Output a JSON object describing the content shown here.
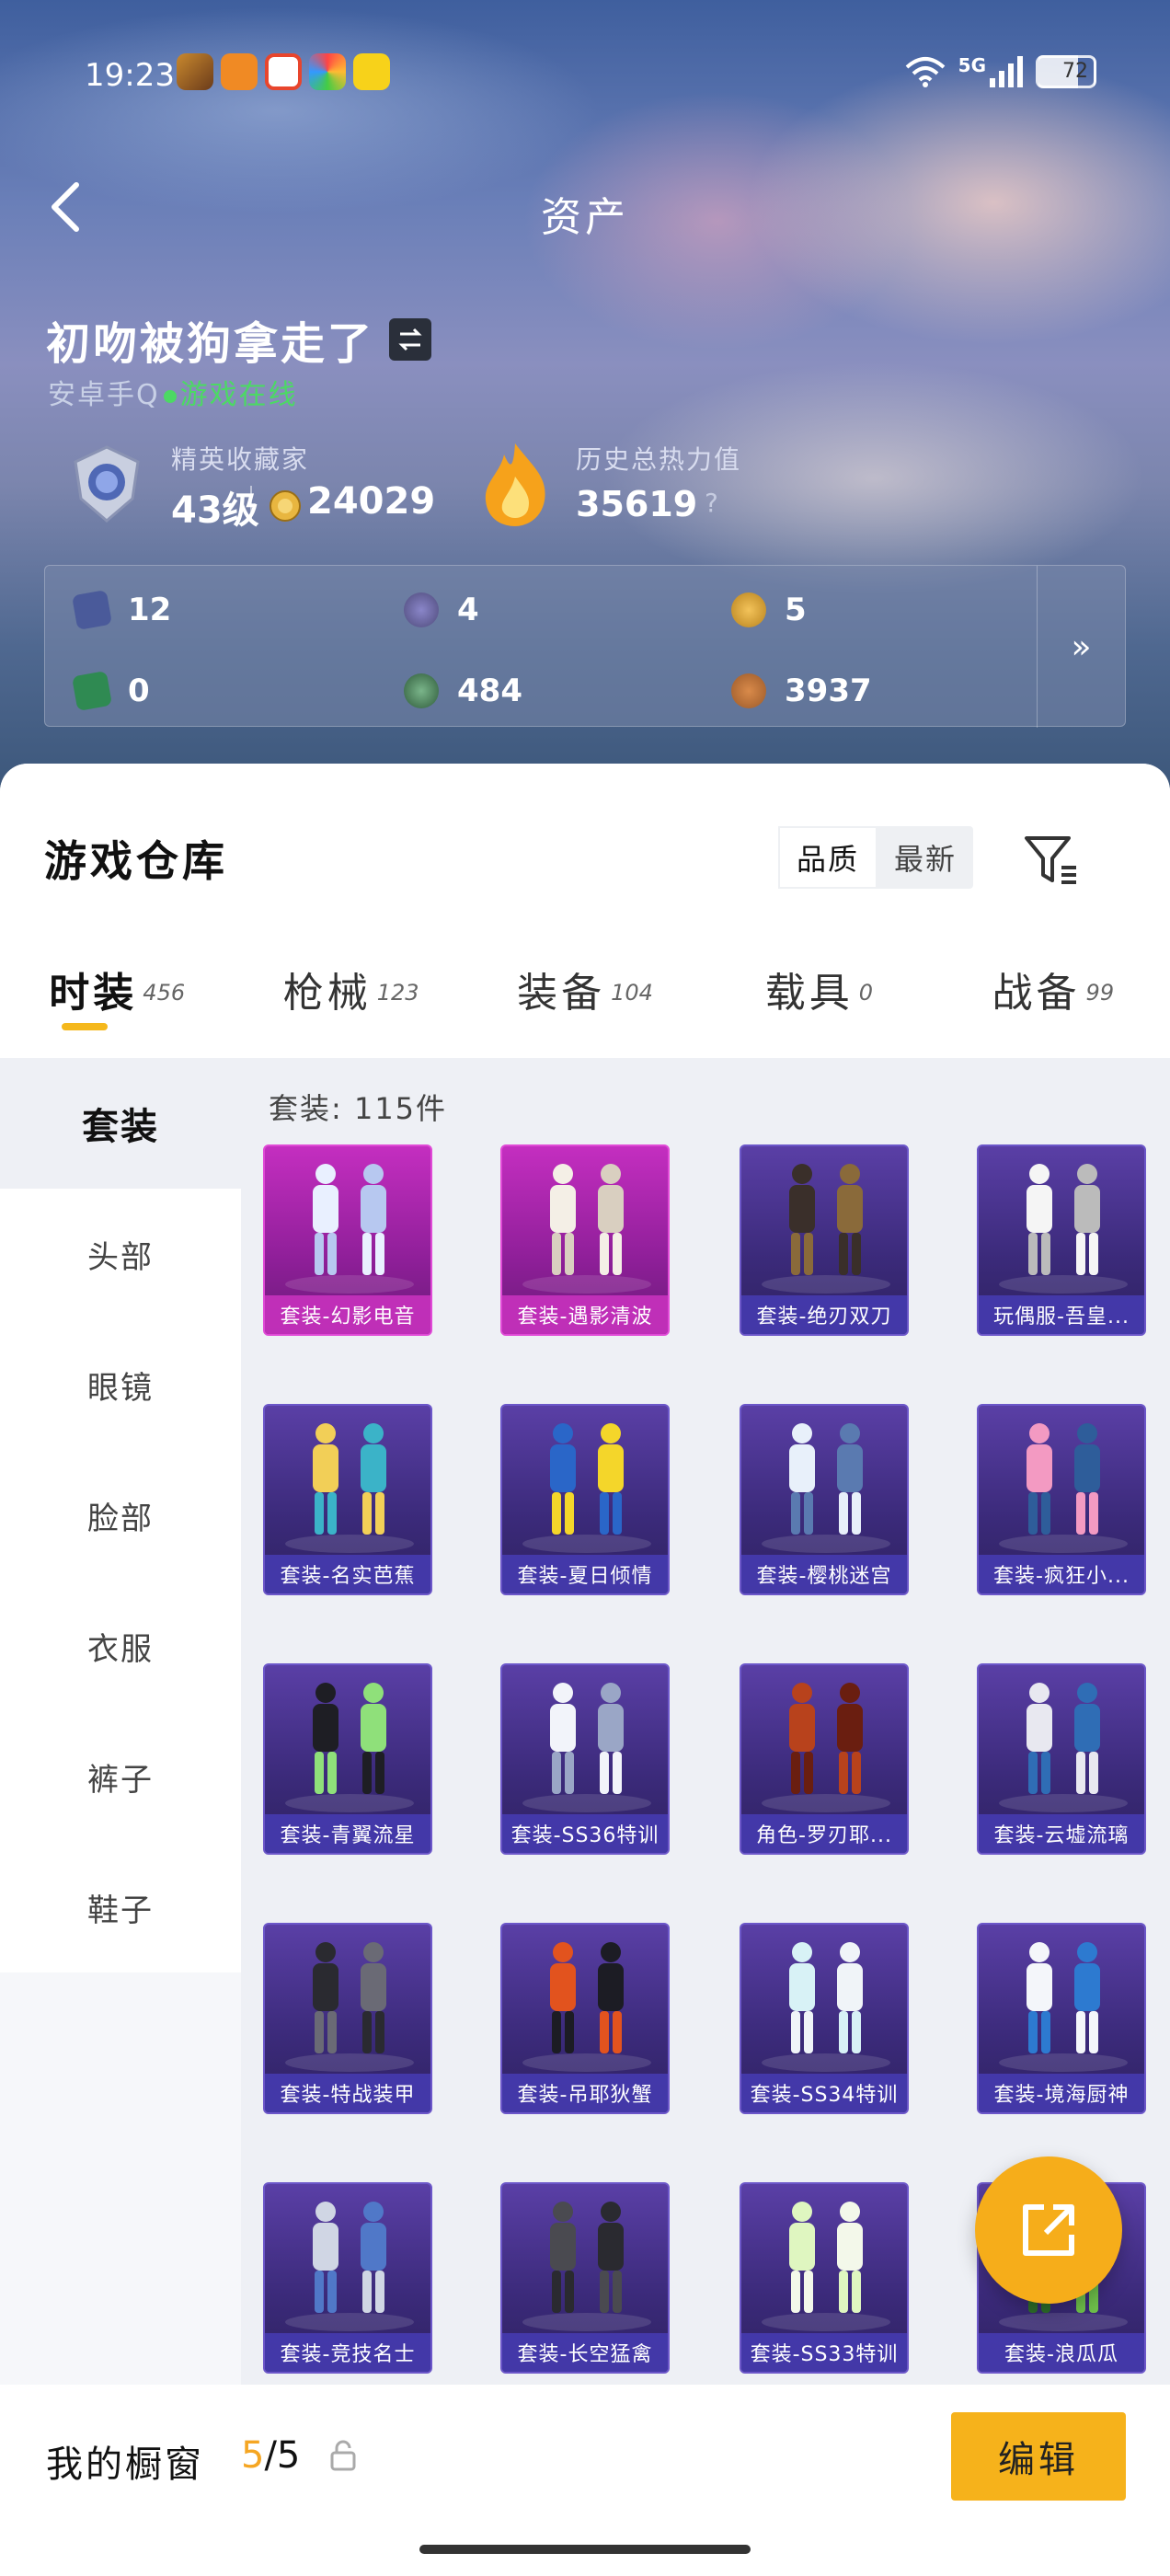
{
  "status_bar": {
    "time": "19:23",
    "network": "5G",
    "battery": "72"
  },
  "nav": {
    "title": "资产"
  },
  "player": {
    "name": "初吻被狗拿走了",
    "platform": "安卓手Q",
    "status": "游戏在线"
  },
  "stats": {
    "collector_title": "精英收藏家",
    "level": "43级",
    "coins": "24029",
    "heat_label": "历史总热力值",
    "heat_value": "35619",
    "help": "?"
  },
  "resources": [
    {
      "icon": "card-icon",
      "value": "12",
      "color": "#4a5a9a"
    },
    {
      "icon": "orb-purple-icon",
      "value": "4",
      "color": "#4e4a7a"
    },
    {
      "icon": "orb-gold-icon",
      "value": "5",
      "color": "#b8821d"
    },
    {
      "icon": "ticket-green-icon",
      "value": "0",
      "color": "#2f8a52"
    },
    {
      "icon": "orb-green-icon",
      "value": "484",
      "color": "#2e5a3a"
    },
    {
      "icon": "orb-bronze-icon",
      "value": "3937",
      "color": "#9b5a2a"
    }
  ],
  "resources_more": "»",
  "warehouse": {
    "title": "游戏仓库",
    "sort_options": [
      "品质",
      "最新"
    ],
    "active_sort": 1
  },
  "tabs": [
    {
      "name": "时装",
      "count": "456"
    },
    {
      "name": "枪械",
      "count": "123"
    },
    {
      "name": "装备",
      "count": "104"
    },
    {
      "name": "载具",
      "count": "0"
    },
    {
      "name": "战备",
      "count": "99"
    }
  ],
  "sidebar": [
    "套装",
    "头部",
    "眼镜",
    "脸部",
    "衣服",
    "裤子",
    "鞋子"
  ],
  "content": {
    "count_label": "套装: 115件",
    "items": [
      {
        "label": "套装-幻影电音",
        "tier": "pink"
      },
      {
        "label": "套装-遇影清波",
        "tier": "pink"
      },
      {
        "label": "套装-绝刃双刀",
        "tier": "purple"
      },
      {
        "label": "玩偶服-吾皇...",
        "tier": "purple"
      },
      {
        "label": "套装-名实芭蕉",
        "tier": "purple"
      },
      {
        "label": "套装-夏日倾情",
        "tier": "purple"
      },
      {
        "label": "套装-樱桃迷宫",
        "tier": "purple"
      },
      {
        "label": "套装-疯狂小...",
        "tier": "purple"
      },
      {
        "label": "套装-青翼流星",
        "tier": "purple"
      },
      {
        "label": "套装-SS36特训",
        "tier": "purple"
      },
      {
        "label": "角色-罗刃耶...",
        "tier": "purple"
      },
      {
        "label": "套装-云墟流璃",
        "tier": "purple"
      },
      {
        "label": "套装-特战装甲",
        "tier": "purple"
      },
      {
        "label": "套装-吊耶狄蟹",
        "tier": "purple"
      },
      {
        "label": "套装-SS34特训",
        "tier": "purple"
      },
      {
        "label": "套装-境海厨神",
        "tier": "purple"
      },
      {
        "label": "套装-竞技名士",
        "tier": "purple"
      },
      {
        "label": "套装-长空猛禽",
        "tier": "purple"
      },
      {
        "label": "套装-SS33特训",
        "tier": "purple"
      },
      {
        "label": "套装-浪瓜瓜",
        "tier": "purple"
      }
    ]
  },
  "showcase": {
    "label": "我的橱窗",
    "current": "5",
    "total": "/5"
  },
  "edit_button": "编辑",
  "colors": {
    "accent": "#f6b21b",
    "pink_tier": "#c42ec0",
    "purple_tier": "#5a3fa6",
    "online": "#4cd964"
  }
}
